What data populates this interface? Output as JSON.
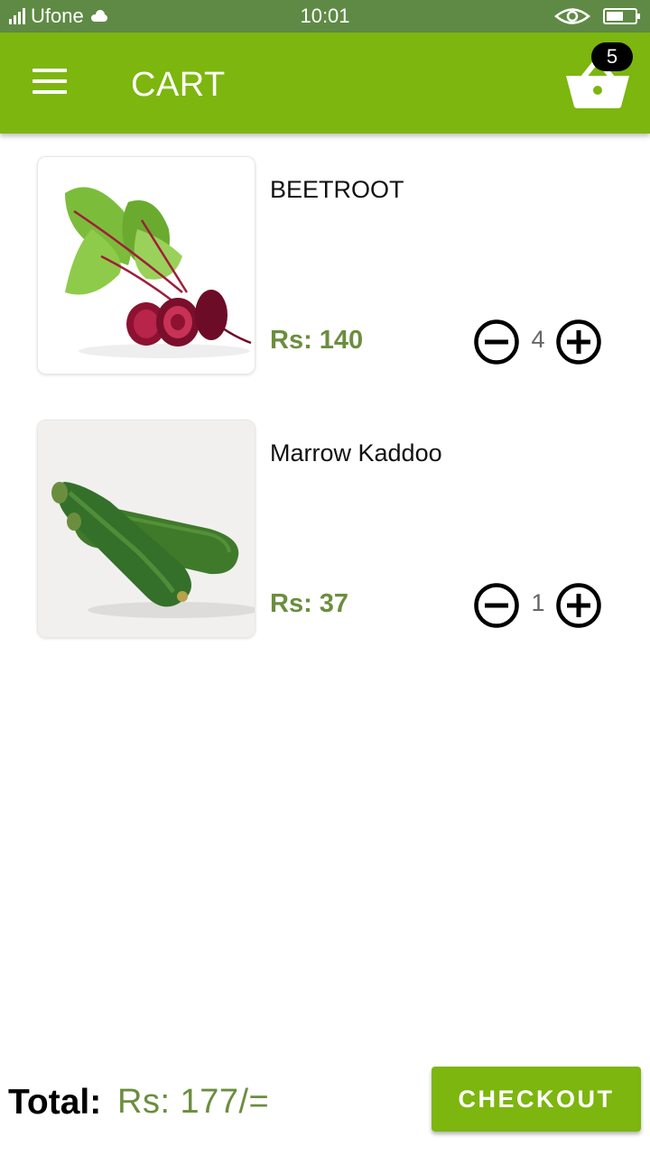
{
  "status_bar": {
    "carrier": "Ufone",
    "time": "10:01",
    "battery_level": 0.6
  },
  "app_bar": {
    "title": "CART",
    "menu_icon": "hamburger-menu-icon",
    "cart_icon": "basket-icon",
    "cart_count": "5"
  },
  "items": [
    {
      "name": "BEETROOT",
      "price": "Rs: 140",
      "quantity": "4",
      "image": "beetroot-image"
    },
    {
      "name": "Marrow Kaddoo",
      "price": "Rs: 37",
      "quantity": "1",
      "image": "marrow-image"
    }
  ],
  "footer": {
    "total_label": "Total:",
    "total_value": "Rs: 177/=",
    "checkout_label": "CHECKOUT"
  },
  "colors": {
    "status_bar": "#5f8a45",
    "app_bar": "#7cb60e",
    "price": "#6b8e3e",
    "checkout_button": "#7cb60e"
  }
}
